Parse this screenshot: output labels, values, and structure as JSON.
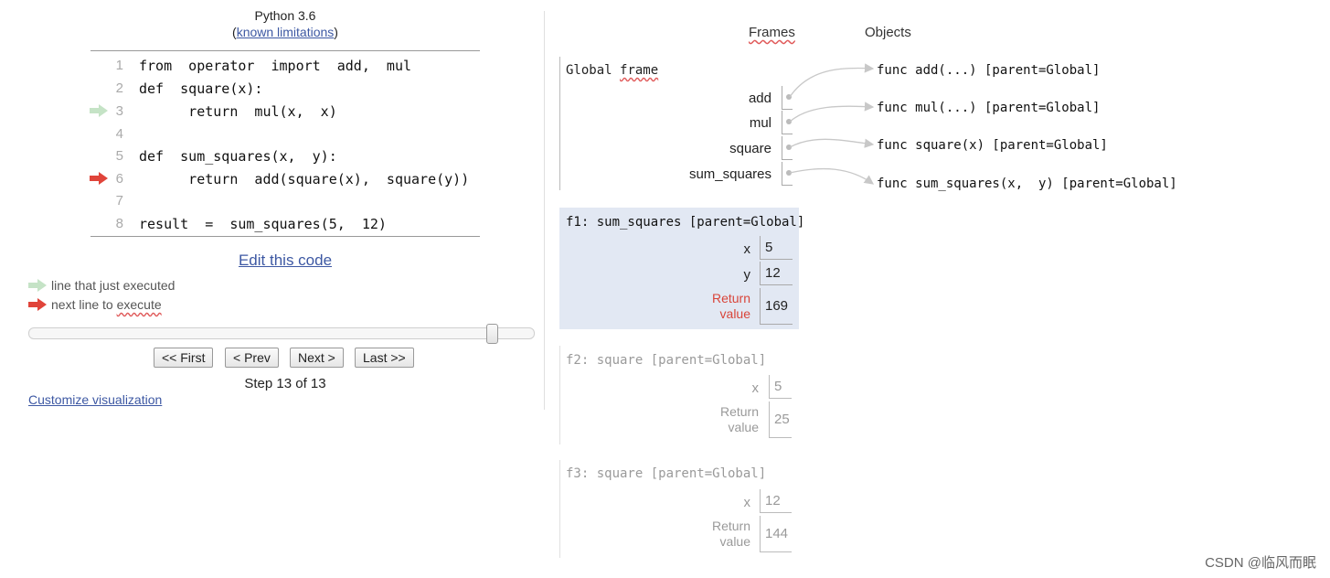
{
  "header": {
    "language": "Python 3.6",
    "limits_open": "(",
    "limits_link": "known limitations",
    "limits_close": ")"
  },
  "code": {
    "lines": [
      {
        "no": "1",
        "text": "from  operator  import  add,  mul"
      },
      {
        "no": "2",
        "text": "def  square(x):"
      },
      {
        "no": "3",
        "text": "      return  mul(x,  x)"
      },
      {
        "no": "4",
        "text": ""
      },
      {
        "no": "5",
        "text": "def  sum_squares(x,  y):"
      },
      {
        "no": "6",
        "text": "      return  add(square(x),  square(y))"
      },
      {
        "no": "7",
        "text": ""
      },
      {
        "no": "8",
        "text": "result  =  sum_squares(5,  12)"
      }
    ],
    "just_executed_line": 3,
    "next_line": 6
  },
  "edit_link": "Edit this code",
  "legend": {
    "green_prefix": "line that just executed",
    "red_prefix": "next line to ",
    "red_squiggle": "execute"
  },
  "colors": {
    "green_arrow": "#c5e3c6",
    "red_arrow": "#e0443a",
    "return_red": "#d9453a",
    "active_frame_bg": "#e2e8f3",
    "link": "#3d58a3"
  },
  "slider": {
    "current_step": 13,
    "total_steps": 13
  },
  "nav": {
    "first": "<< First",
    "prev": "< Prev",
    "next": "Next >",
    "last": "Last >>"
  },
  "step_text": "Step 13 of 13",
  "customize_link": "Customize visualization",
  "viz": {
    "frames_header": "Frames",
    "objects_header": "Objects",
    "global_frame": {
      "title_prefix": "Global ",
      "title_squiggle": "frame",
      "vars": [
        "add",
        "mul",
        "square",
        "sum_squares"
      ]
    },
    "objects": [
      "func add(...) [parent=Global]",
      "func mul(...) [parent=Global]",
      "func square(x) [parent=Global]",
      "func sum_squares(x,  y) [parent=Global]"
    ],
    "f1": {
      "title": "f1: sum_squares [parent=Global]",
      "vars": [
        {
          "name": "x",
          "value": "5"
        },
        {
          "name": "y",
          "value": "12"
        }
      ],
      "return_label_1": "Return",
      "return_label_2": "value",
      "return_value": "169"
    },
    "f2": {
      "title": "f2: square [parent=Global]",
      "vars": [
        {
          "name": "x",
          "value": "5"
        }
      ],
      "return_label_1": "Return",
      "return_label_2": "value",
      "return_value": "25"
    },
    "f3": {
      "title": "f3: square [parent=Global]",
      "vars": [
        {
          "name": "x",
          "value": "12"
        }
      ],
      "return_label_1": "Return",
      "return_label_2": "value",
      "return_value": "144"
    }
  },
  "watermark": "CSDN @临风而眠"
}
